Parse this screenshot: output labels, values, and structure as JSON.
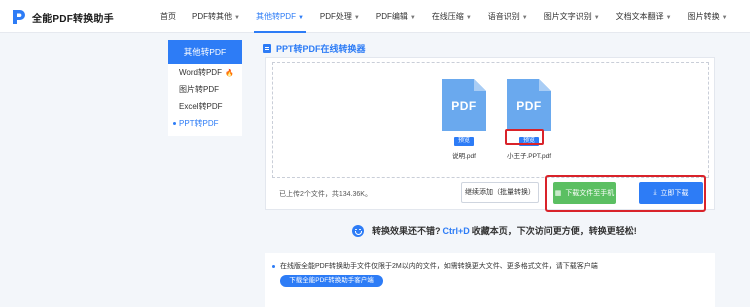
{
  "app": {
    "name": "全能PDF转换助手"
  },
  "nav": [
    {
      "label": "首页",
      "caret": false,
      "active": false
    },
    {
      "label": "PDF转其他",
      "caret": true,
      "active": false
    },
    {
      "label": "其他转PDF",
      "caret": true,
      "active": true
    },
    {
      "label": "PDF处理",
      "caret": true,
      "active": false
    },
    {
      "label": "PDF编辑",
      "caret": true,
      "active": false
    },
    {
      "label": "在线压缩",
      "caret": true,
      "active": false
    },
    {
      "label": "语音识别",
      "caret": true,
      "active": false
    },
    {
      "label": "图片文字识别",
      "caret": true,
      "active": false
    },
    {
      "label": "文档文本翻译",
      "caret": true,
      "active": false
    },
    {
      "label": "图片转换",
      "caret": true,
      "active": false
    }
  ],
  "sidebar": {
    "title": "其他转PDF",
    "items": [
      {
        "label": "Word转PDF",
        "hot": true
      },
      {
        "label": "图片转PDF",
        "hot": false
      },
      {
        "label": "Excel转PDF",
        "hot": false
      },
      {
        "label": "PPT转PDF",
        "hot": false,
        "active": true
      }
    ]
  },
  "main": {
    "title": "PPT转PDF在线转换器",
    "files": [
      {
        "icon_text": "PDF",
        "preview_label": "预览",
        "name": "说明.pdf"
      },
      {
        "icon_text": "PDF",
        "preview_label": "预览",
        "name": "小王子.PPT.pdf"
      }
    ],
    "status": "已上传2个文件，共134.36K。",
    "add_more_label": "继续添加（批量转换）",
    "download_phone_label": "下载文件至手机",
    "download_now_label": "立即下载"
  },
  "praise": {
    "before": "转换效果还不错?",
    "shortcut": "Ctrl+D",
    "after": "收藏本页，下次访问更方便，转换更轻松!"
  },
  "notice": {
    "text": "在线版全能PDF转换助手文件仅限于2M以内的文件，如需转换更大文件、更多格式文件，请下载客户端",
    "button": "下载全能PDF转换助手客户端"
  },
  "colors": {
    "accent": "#2d7cf6",
    "green": "#5bbf62",
    "highlight_red": "#d9232a",
    "pdf_icon": "#6aa9ee"
  },
  "icons": {
    "logo": "p-logo-icon",
    "hot": "fire-icon",
    "phone": "qr-icon",
    "download": "download-icon",
    "smile": "smile-icon"
  }
}
